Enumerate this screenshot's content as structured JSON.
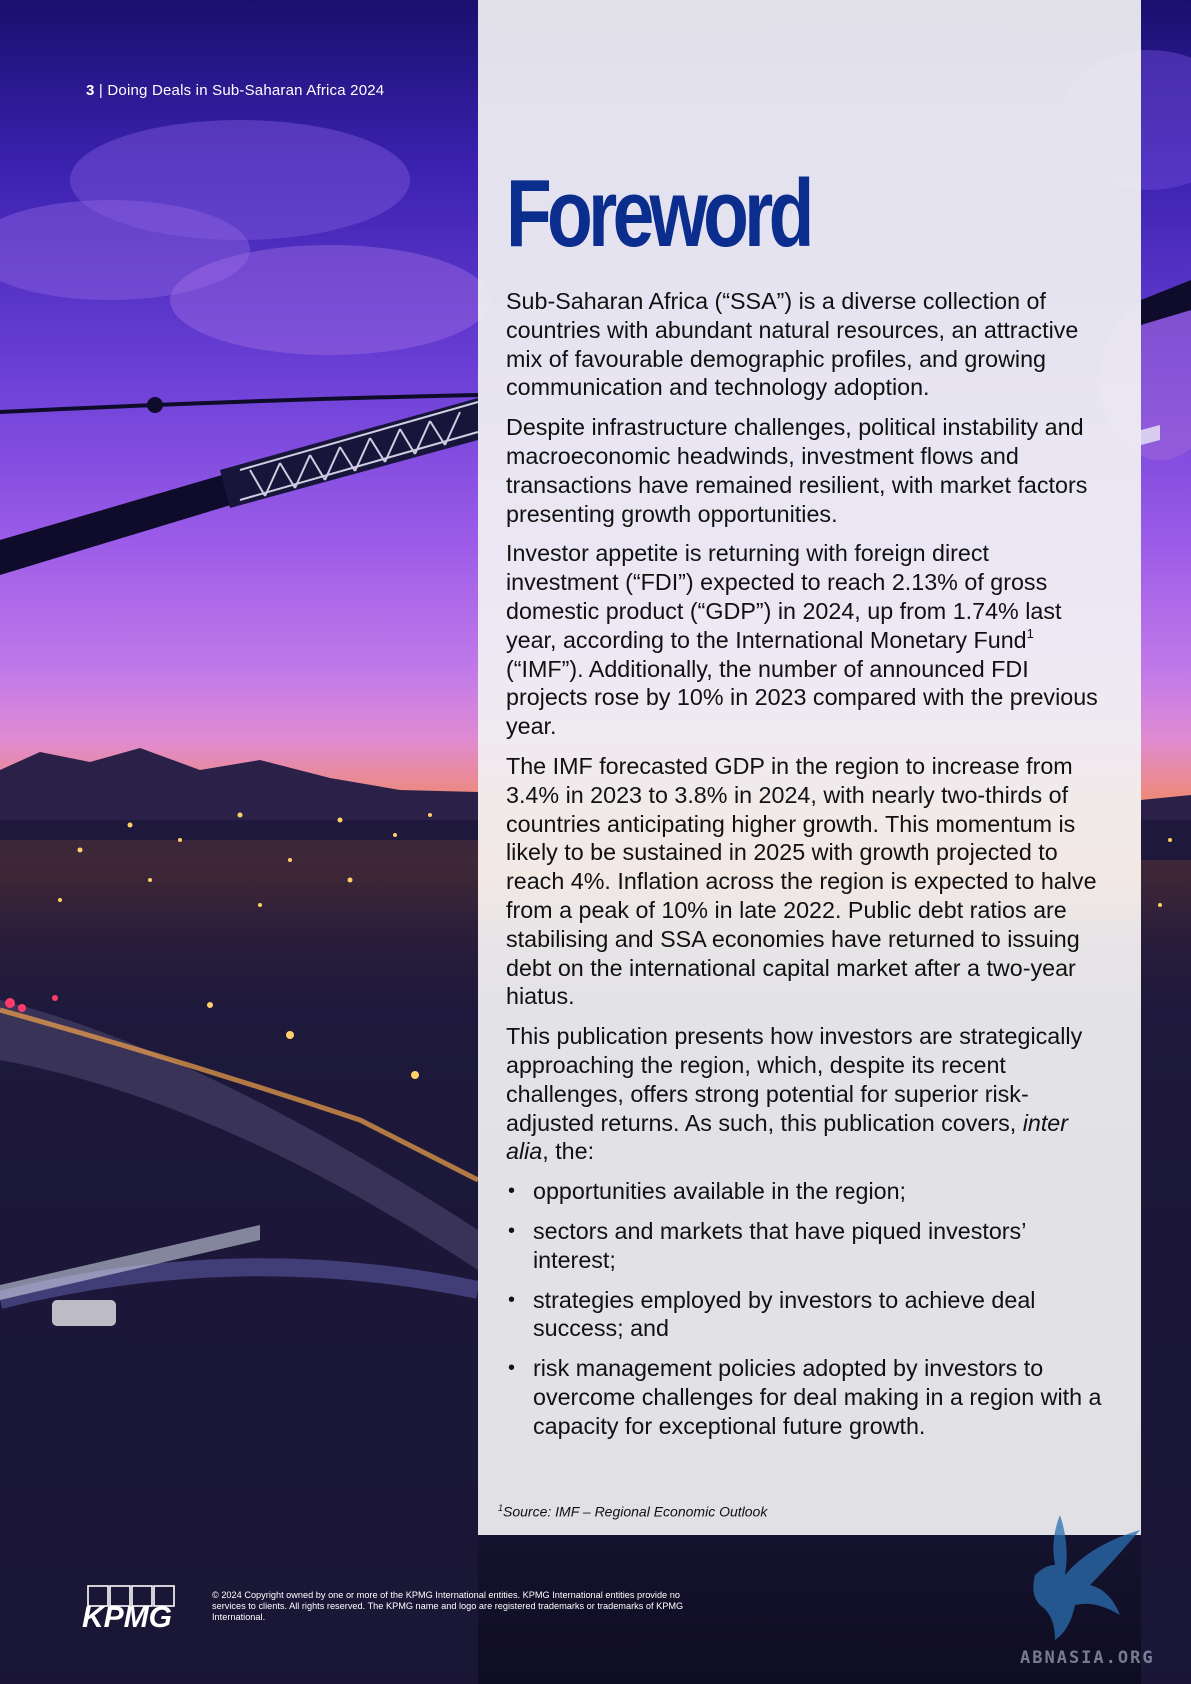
{
  "header": {
    "page_number": "3",
    "separator": " | ",
    "doc_title": "Doing Deals in Sub-Saharan Africa 2024"
  },
  "title": "Foreword",
  "paragraphs": {
    "p1": "Sub-Saharan Africa (“SSA”) is a diverse collection of countries with abundant natural resources, an attractive mix of favourable demographic profiles, and growing communication and technology adoption.",
    "p2": "Despite infrastructure challenges, political instability and macroeconomic headwinds, investment flows and transactions have remained resilient, with market factors presenting growth opportunities.",
    "p3a": "Investor appetite is returning with foreign direct investment (“FDI”) expected to reach 2.13% of gross domestic product (“GDP”) in 2024, up from 1.74% last year, according to the International Monetary Fund",
    "p3_sup": "1",
    "p3b": " (“IMF”). Additionally, the number of announced FDI projects rose by 10% in 2023 compared with the previous year.",
    "p4": "The IMF forecasted GDP in the region to increase from 3.4% in 2023 to 3.8% in 2024, with nearly two-thirds of countries anticipating higher growth. This momentum is likely to be sustained in 2025 with growth projected to reach 4%. Inflation across the region is expected to halve from a peak of 10% in late 2022. Public debt ratios are stabilising and SSA economies have returned to issuing debt on the international capital market after a two-year hiatus.",
    "p5a": "This publication presents how investors are strategically approaching the region, which, despite its recent challenges, offers strong potential for superior risk-adjusted returns. As such, this publication covers, ",
    "p5_italic": "inter alia",
    "p5b": ", the:"
  },
  "bullets": [
    "opportunities available in the region;",
    "sectors and markets that have piqued investors’ interest;",
    "strategies employed by investors to achieve deal success; and",
    "risk management policies adopted by investors to overcome challenges for deal making in a region with a capacity for exceptional future growth."
  ],
  "footnote": {
    "sup": "1",
    "text": "Source: IMF – Regional Economic Outlook"
  },
  "footer": {
    "logo_text": "KPMG",
    "copyright": "© 2024 Copyright owned by one or more of the KPMG International entities. KPMG International entities provide no services to clients. All rights reserved. The KPMG name and logo are registered trademarks or trademarks of KPMG International."
  },
  "watermark": {
    "text": "ABNASIA.ORG"
  },
  "colors": {
    "title": "#0a2d8e",
    "panel": "#f1f1f3",
    "text": "#111111"
  }
}
